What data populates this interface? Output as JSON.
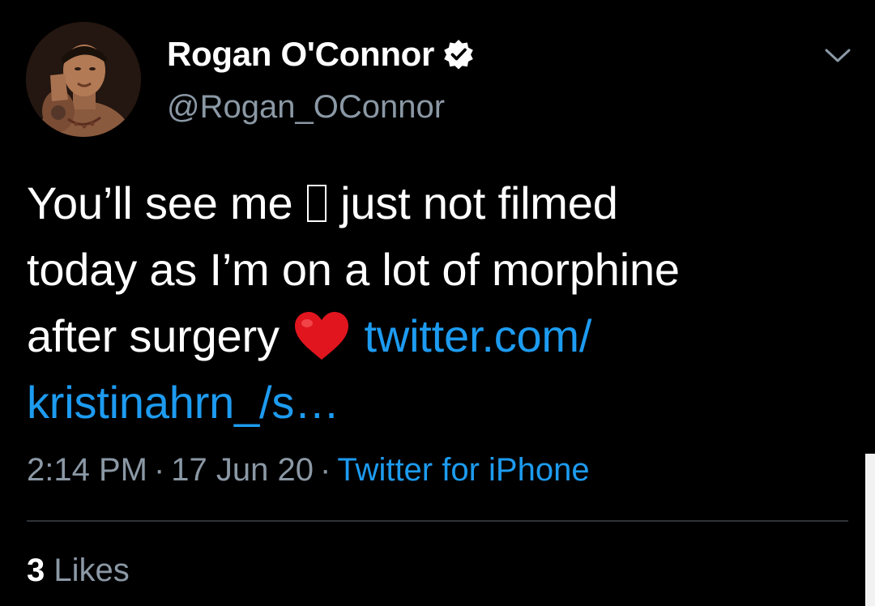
{
  "tweet": {
    "author": {
      "display_name": "Rogan O'Connor",
      "handle": "@Rogan_OConnor",
      "verified": true
    },
    "text_line1_a": "You’ll see me ",
    "text_line1_b": " just not filmed",
    "text_line2": "today as I’m on a lot of morphine",
    "text_line3": "after surgery ",
    "link_part1": "twitter.com/",
    "link_part2": "kristinahrn_/s…",
    "time": "2:14 PM",
    "date": "17 Jun 20",
    "separator": "·",
    "source": "Twitter for iPhone",
    "likes_count": "3",
    "likes_label": "Likes"
  },
  "icons": {
    "verified": "verified-badge-icon",
    "menu": "chevron-down-icon",
    "missing_emoji": "missing-glyph-box",
    "heart": "red-heart-emoji"
  },
  "colors": {
    "background": "#000000",
    "text": "#ffffff",
    "secondary": "#8b98a5",
    "link": "#1d9bf0",
    "heart": "#e0151e",
    "divider": "#2f3336"
  }
}
